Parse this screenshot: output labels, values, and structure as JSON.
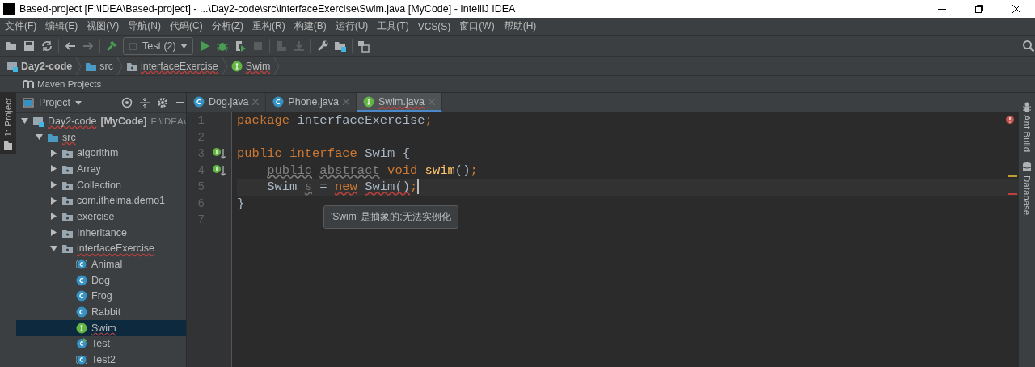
{
  "window": {
    "title": "Based-project [F:\\IDEA\\Based-project] - ...\\Day2-code\\src\\interfaceExercise\\Swim.java [MyCode] - IntelliJ IDEA"
  },
  "menu": [
    "文件(F)",
    "编辑(E)",
    "视图(V)",
    "导航(N)",
    "代码(C)",
    "分析(Z)",
    "重构(R)",
    "构建(B)",
    "运行(U)",
    "工具(T)",
    "VCS(S)",
    "窗口(W)",
    "帮助(H)"
  ],
  "toolbar": {
    "run_config": "Test (2)"
  },
  "breadcrumbs": [
    {
      "label": "Day2-code",
      "kind": "module",
      "error": false
    },
    {
      "label": "src",
      "kind": "source_folder",
      "error": false
    },
    {
      "label": "interfaceExercise",
      "kind": "package",
      "error": true
    },
    {
      "label": "Swim",
      "kind": "interface",
      "error": true
    }
  ],
  "maven_bar": {
    "label": "Maven Projects"
  },
  "left_strip": {
    "label": "1: Project"
  },
  "project_panel": {
    "title": "Project"
  },
  "tree": [
    {
      "label": "Day2-code",
      "tag": "[MyCode]",
      "path": "F:\\IDEA\\",
      "kind": "module",
      "expanded": true,
      "selected": false,
      "error": true,
      "children": [
        {
          "label": "src",
          "kind": "source_folder",
          "expanded": true,
          "selected": false,
          "error": true,
          "children": [
            {
              "label": "algorithm",
              "kind": "package",
              "expanded": false,
              "selected": false,
              "error": false
            },
            {
              "label": "Array",
              "kind": "package",
              "expanded": false,
              "selected": false,
              "error": false
            },
            {
              "label": "Collection",
              "kind": "package",
              "expanded": false,
              "selected": false,
              "error": false
            },
            {
              "label": "com.itheima.demo1",
              "kind": "package",
              "expanded": false,
              "selected": false,
              "error": false
            },
            {
              "label": "exercise",
              "kind": "package",
              "expanded": false,
              "selected": false,
              "error": false
            },
            {
              "label": "Inheritance",
              "kind": "package",
              "expanded": false,
              "selected": false,
              "error": false
            },
            {
              "label": "interfaceExercise",
              "kind": "package",
              "expanded": true,
              "selected": false,
              "error": true,
              "children": [
                {
                  "label": "Animal",
                  "kind": "abstract_class",
                  "selected": false,
                  "error": false
                },
                {
                  "label": "Dog",
                  "kind": "class",
                  "selected": false,
                  "error": false
                },
                {
                  "label": "Frog",
                  "kind": "class",
                  "selected": false,
                  "error": false
                },
                {
                  "label": "Rabbit",
                  "kind": "class",
                  "selected": false,
                  "error": false
                },
                {
                  "label": "Swim",
                  "kind": "interface",
                  "selected": true,
                  "error": true
                },
                {
                  "label": "Test",
                  "kind": "test_class",
                  "selected": false,
                  "error": false
                },
                {
                  "label": "Test2",
                  "kind": "abstract_class",
                  "selected": false,
                  "error": false
                }
              ]
            }
          ]
        }
      ]
    }
  ],
  "tabs": [
    {
      "label": "Dog.java",
      "kind": "class",
      "selected": false,
      "error": false
    },
    {
      "label": "Phone.java",
      "kind": "class",
      "selected": false,
      "error": false
    },
    {
      "label": "Swim.java",
      "kind": "interface",
      "selected": true,
      "error": true
    }
  ],
  "code": [
    {
      "number": "1",
      "marker": false,
      "current": false,
      "tokens": [
        {
          "text": "package",
          "kind": "keyword"
        },
        {
          "text": " interfaceExercise",
          "kind": "plain"
        },
        {
          "text": ";",
          "kind": "keyword"
        }
      ]
    },
    {
      "number": "2",
      "marker": false,
      "current": false
    },
    {
      "number": "3",
      "marker": true,
      "current": false,
      "tokens": [
        {
          "text": "public",
          "kind": "keyword"
        },
        {
          "text": " interface",
          "kind": "keyword"
        },
        {
          "text": " Swim {",
          "kind": "plain"
        }
      ]
    },
    {
      "number": "4",
      "marker": true,
      "current": false,
      "tokens": [
        {
          "text": "    public",
          "kind": "redundant"
        },
        {
          "text": " abstract",
          "kind": "redundant"
        },
        {
          "text": " void",
          "kind": "keyword"
        },
        {
          "text": " swim",
          "kind": "method"
        },
        {
          "text": "()",
          "kind": "plain"
        },
        {
          "text": ";",
          "kind": "keyword"
        }
      ]
    },
    {
      "number": "5",
      "marker": false,
      "current": true,
      "tokens": [
        {
          "text": "    Swim ",
          "kind": "plain"
        },
        {
          "text": "s",
          "kind": "unused"
        },
        {
          "text": " = ",
          "kind": "plain"
        },
        {
          "text": "new",
          "kind": "error_keyword"
        },
        {
          "text": " Swim()",
          "kind": "error_plain"
        },
        {
          "text": ";",
          "kind": "keyword"
        }
      ]
    },
    {
      "number": "6",
      "marker": false,
      "current": false,
      "tokens": [
        {
          "text": "}",
          "kind": "plain"
        }
      ]
    },
    {
      "number": "7",
      "marker": false,
      "current": false
    }
  ],
  "tooltip": "'Swim' 是抽象的;无法实例化",
  "right_strip": [
    {
      "label": "Ant Build",
      "kind": "ant"
    },
    {
      "label": "Database",
      "kind": "database"
    }
  ]
}
